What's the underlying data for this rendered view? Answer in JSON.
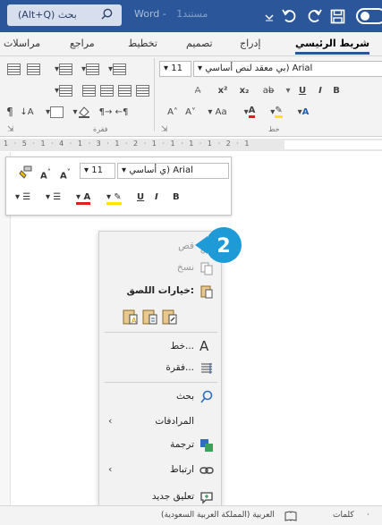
{
  "titlebar": {
    "search_text": "(Alt+Q) بحث",
    "app_name": "Word",
    "doc_name": "مستند1"
  },
  "ribbon_tabs": [
    "شريط الرئيسي",
    "إدراج",
    "تصميم",
    "تخطيط",
    "مراجع",
    "مراسلات"
  ],
  "ribbon": {
    "font_name": "بي معقد لنص أساسي) Arial",
    "font_size": "11",
    "group_paragraph": "فقرة",
    "group_font": "خط"
  },
  "ruler": {
    "marks": "1 · 5 · 1 · 4 · 1 · 3 · 1 · 2 · 1 · 1 · 1 · 1 · 2 · 1"
  },
  "mini_toolbar": {
    "font_name": "ي أساسي) Arial",
    "font_size": "11",
    "bold": "B",
    "italic": "I",
    "underline": "U",
    "grow": "A",
    "shrink": "A"
  },
  "context_menu": {
    "cut": "قص",
    "copy": "نسخ",
    "paste_options": "خيارات اللصق:",
    "font": "خط...",
    "paragraph": "فقرة...",
    "search": "بحث",
    "synonyms": "المرادفات",
    "translate": "ترجمة",
    "link": "ارتباط",
    "new_comment": "تعليق جديد"
  },
  "badge": {
    "number": "2",
    "color": "#1e9bd7"
  },
  "status": {
    "words": "كلمات",
    "language": "العربية (المملكة العربية السعودية)"
  },
  "colors": {
    "accent": "#2b579a",
    "badge": "#1e9bd7"
  }
}
